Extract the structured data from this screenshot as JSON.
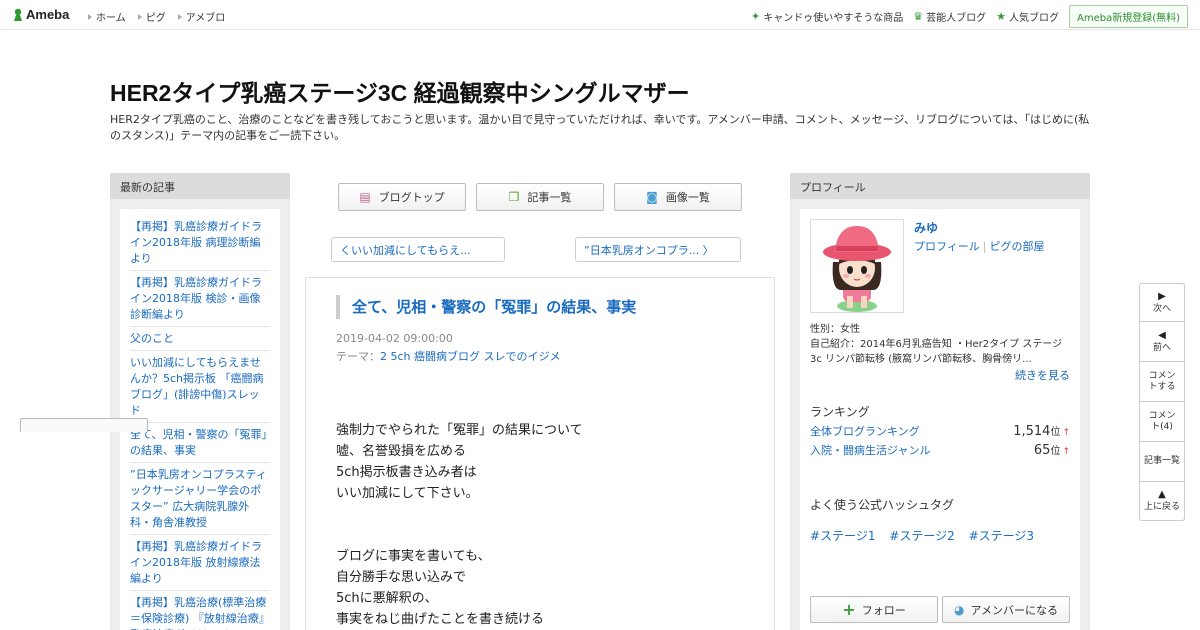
{
  "topbar": {
    "logo": "Ameba",
    "nav": [
      "ホーム",
      "ピグ",
      "アメブロ"
    ],
    "right_links": [
      {
        "icon": "sparkle-icon",
        "label": "キャンドゥ使いやすそうな商品"
      },
      {
        "icon": "crown-icon",
        "label": "芸能人ブログ"
      },
      {
        "icon": "star-icon",
        "label": "人気ブログ"
      }
    ],
    "register": "Ameba新規登録(無料)"
  },
  "blog": {
    "title": "HER2タイプ乳癌ステージ3C 経過観察中シングルマザー",
    "description": "HER2タイプ乳癌のこと、治療のことなどを書き残しておこうと思います。温かい目で見守っていただければ、幸いです。アメンバー申請、コメント、メッセージ、リブログについては、「はじめに(私のスタンス)」テーマ内の記事をご一読下さい。"
  },
  "left": {
    "heading": "最新の記事",
    "items": [
      "【再掲】乳癌診療ガイドライン2018年版 病理診断編より",
      "【再掲】乳癌診療ガイドライン2018年版 検診・画像診断編より",
      "父のこと",
      "いい加減にしてもらえませんか？5ch掲示板 「癌闘病ブログ」(誹謗中傷)スレッド",
      "全て、児相・警察の「冤罪」の結果、事実",
      "”日本乳房オンコプラスティックサージャリー学会のポスター” 広大病院乳腺外科・角舎准教授",
      "【再掲】乳癌診療ガイドライン2018年版 放射線療法編より",
      "【再掲】乳癌治療(標準治療＝保険診療) 『放射線治療』乳癌診療ガイドライン"
    ]
  },
  "center": {
    "buttons": [
      {
        "icon": "document-icon",
        "label": "ブログトップ"
      },
      {
        "icon": "list-icon",
        "label": "記事一覧"
      },
      {
        "icon": "camera-icon",
        "label": "画像一覧"
      }
    ],
    "prev": "くいい加減にしてもらえ...",
    "next": "”日本乳房オンコプラ... 〉",
    "article": {
      "title": "全て、児相・警察の「冤罪」の結果、事実",
      "date": "2019-04-02 09:00:00",
      "theme_label": "テーマ：",
      "theme": "2 5ch 癌闘病ブログ スレでのイジメ",
      "paragraph1": [
        "強制力でやられた「冤罪」の結果について",
        "嘘、名誉毀損を広める",
        "5ch掲示板書き込み者は",
        "いい加減にして下さい。"
      ],
      "paragraph2": [
        "ブログに事実を書いても、",
        "自分勝手な思い込みで",
        "5chに悪解釈の、",
        "事実をねじ曲げたことを書き続ける"
      ]
    }
  },
  "right": {
    "heading": "プロフィール",
    "name": "みゆ",
    "link_profile": "プロフィール",
    "link_room": "ピグの部屋",
    "gender": "性別：女性",
    "intro": "自己紹介：2014年6月乳癌告知 ・Her2タイプ ステージ3c リンパ節転移 (腋窩リンパ節転移、胸骨傍リ...",
    "more": "続きを見る",
    "ranking_heading": "ランキング",
    "rankings": [
      {
        "label": "全体ブログランキング",
        "value": "1,514",
        "unit": "位",
        "arrow": "↑"
      },
      {
        "label": "入院・闘病生活ジャンル",
        "value": "65",
        "unit": "位",
        "arrow": "↑"
      }
    ],
    "hashtag_heading": "よく使う公式ハッシュタグ",
    "hashtags": [
      "#ステージ1",
      "#ステージ2",
      "#ステージ3"
    ],
    "follow": "フォロー",
    "amember": "アメンバーになる"
  },
  "sidenav": [
    {
      "icon": "triangle-right-icon",
      "label": "次へ"
    },
    {
      "icon": "triangle-left-icon",
      "label": "前へ"
    },
    {
      "icon": "",
      "label": "コメントする"
    },
    {
      "icon": "",
      "label": "コメント(4)"
    },
    {
      "icon": "",
      "label": "記事一覧"
    },
    {
      "icon": "triangle-up-icon",
      "label": "上に戻る"
    }
  ]
}
